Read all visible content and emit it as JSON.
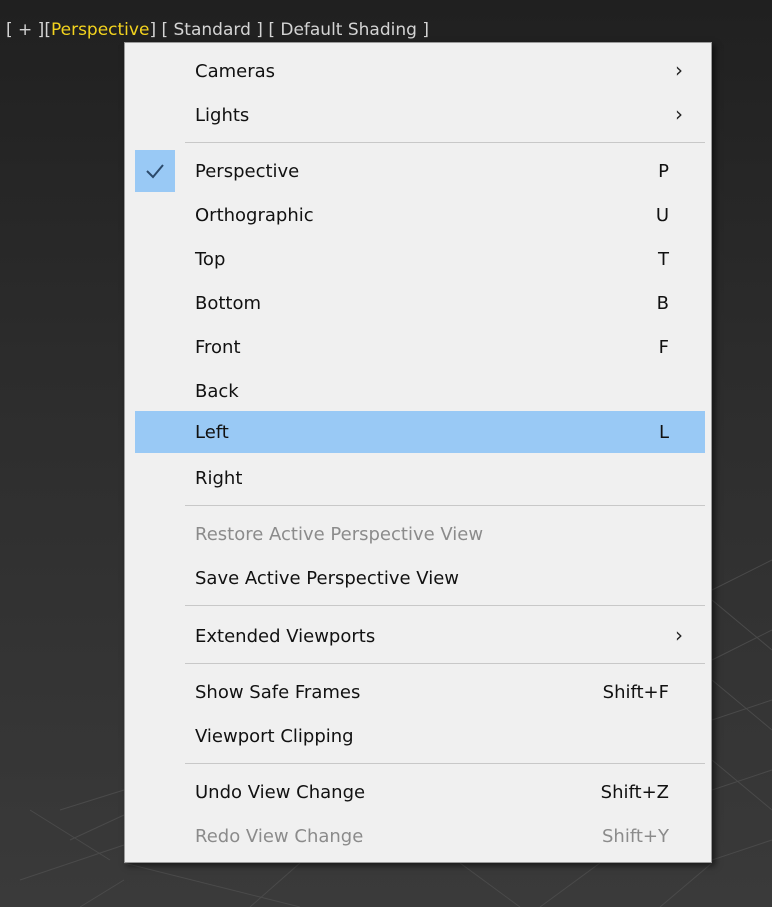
{
  "viewport": {
    "labels": {
      "plus": "[ + ]",
      "view": "Perspective",
      "view_open": "[",
      "view_close": "]",
      "shading_mode": "[ Standard ]",
      "shading": "[ Default Shading ]"
    },
    "colors": {
      "active_label": "#f3d31e",
      "menu_highlight": "#99c9f5"
    }
  },
  "menu": {
    "cameras": "Cameras",
    "lights": "Lights",
    "perspective": {
      "label": "Perspective",
      "shortcut": "P"
    },
    "orthographic": {
      "label": "Orthographic",
      "shortcut": "U"
    },
    "top": {
      "label": "Top",
      "shortcut": "T"
    },
    "bottom": {
      "label": "Bottom",
      "shortcut": "B"
    },
    "front": {
      "label": "Front",
      "shortcut": "F"
    },
    "back": {
      "label": "Back",
      "shortcut": ""
    },
    "left": {
      "label": "Left",
      "shortcut": "L"
    },
    "right": {
      "label": "Right",
      "shortcut": ""
    },
    "restore_view": "Restore Active Perspective View",
    "save_view": "Save Active Perspective View",
    "extended_viewports": "Extended Viewports",
    "safe_frames": {
      "label": "Show Safe Frames",
      "shortcut": "Shift+F"
    },
    "viewport_clipping": "Viewport Clipping",
    "undo": {
      "label": "Undo View Change",
      "shortcut": "Shift+Z"
    },
    "redo": {
      "label": "Redo View Change",
      "shortcut": "Shift+Y"
    },
    "submenu_arrow": "›"
  }
}
